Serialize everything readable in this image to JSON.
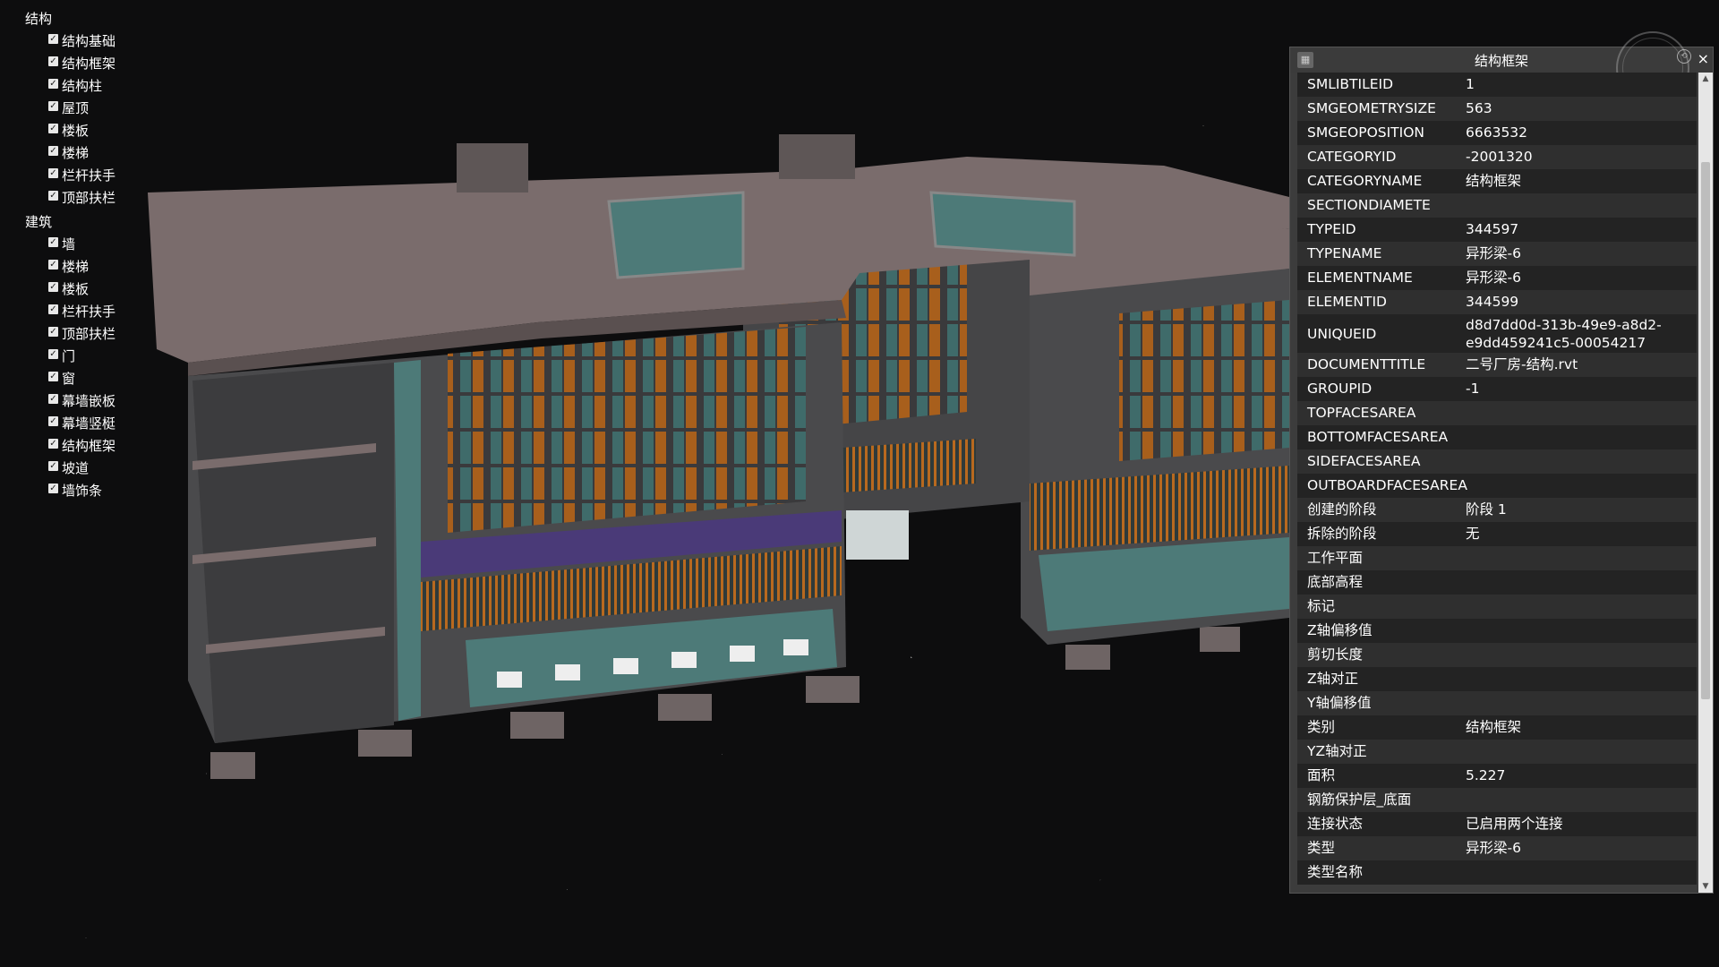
{
  "layer_tree": {
    "groups": [
      {
        "label": "结构",
        "items": [
          "结构基础",
          "结构框架",
          "结构柱",
          "屋顶",
          "楼板",
          "楼梯",
          "栏杆扶手",
          "顶部扶栏"
        ]
      },
      {
        "label": "建筑",
        "items": [
          "墙",
          "楼梯",
          "楼板",
          "栏杆扶手",
          "顶部扶栏",
          "门",
          "窗",
          "幕墙嵌板",
          "幕墙竖梃",
          "结构框架",
          "坡道",
          "墙饰条"
        ]
      }
    ],
    "checkbox_glyph": "✓"
  },
  "panel": {
    "title": "结构框架",
    "close_label": "×",
    "rows": [
      {
        "k": "SMLIBTILEID",
        "v": "1"
      },
      {
        "k": "SMGEOMETRYSIZE",
        "v": "563"
      },
      {
        "k": "SMGEOPOSITION",
        "v": "6663532"
      },
      {
        "k": "CATEGORYID",
        "v": "-2001320"
      },
      {
        "k": "CATEGORYNAME",
        "v": "结构框架"
      },
      {
        "k": "SECTIONDIAMETE",
        "v": ""
      },
      {
        "k": "TYPEID",
        "v": "344597"
      },
      {
        "k": "TYPENAME",
        "v": "异形梁-6"
      },
      {
        "k": "ELEMENTNAME",
        "v": "异形梁-6"
      },
      {
        "k": "ELEMENTID",
        "v": "344599"
      },
      {
        "k": "UNIQUEID",
        "v": "d8d7dd0d-313b-49e9-a8d2-e9dd459241c5-00054217"
      },
      {
        "k": "DOCUMENTTITLE",
        "v": "二号厂房-结构.rvt"
      },
      {
        "k": "GROUPID",
        "v": "-1"
      },
      {
        "k": "TOPFACESAREA",
        "v": ""
      },
      {
        "k": "BOTTOMFACESAREA",
        "v": ""
      },
      {
        "k": "SIDEFACESAREA",
        "v": ""
      },
      {
        "k": "OUTBOARDFACESAREA",
        "v": ""
      },
      {
        "k": "创建的阶段",
        "v": "阶段 1"
      },
      {
        "k": "拆除的阶段",
        "v": "无"
      },
      {
        "k": "工作平面",
        "v": ""
      },
      {
        "k": "底部高程",
        "v": ""
      },
      {
        "k": "标记",
        "v": ""
      },
      {
        "k": "Z轴偏移值",
        "v": ""
      },
      {
        "k": "剪切长度",
        "v": ""
      },
      {
        "k": "Z轴对正",
        "v": ""
      },
      {
        "k": "Y轴偏移值",
        "v": ""
      },
      {
        "k": "类别",
        "v": "结构框架"
      },
      {
        "k": "YZ轴对正",
        "v": ""
      },
      {
        "k": "面积",
        "v": "5.227"
      },
      {
        "k": "钢筋保护层_底面",
        "v": ""
      },
      {
        "k": "连接状态",
        "v": "已启用两个连接"
      },
      {
        "k": "类型",
        "v": "异形梁-6"
      },
      {
        "k": "类型名称",
        "v": ""
      }
    ]
  },
  "colors": {
    "background": "#0d0d0e",
    "roof": "#7a6c6c",
    "wall": "#4a4a4c",
    "glass": "#4d7a78",
    "louver": "#b8691f",
    "band": "#4a3a78",
    "panel_bg": "#3c3c3c"
  }
}
